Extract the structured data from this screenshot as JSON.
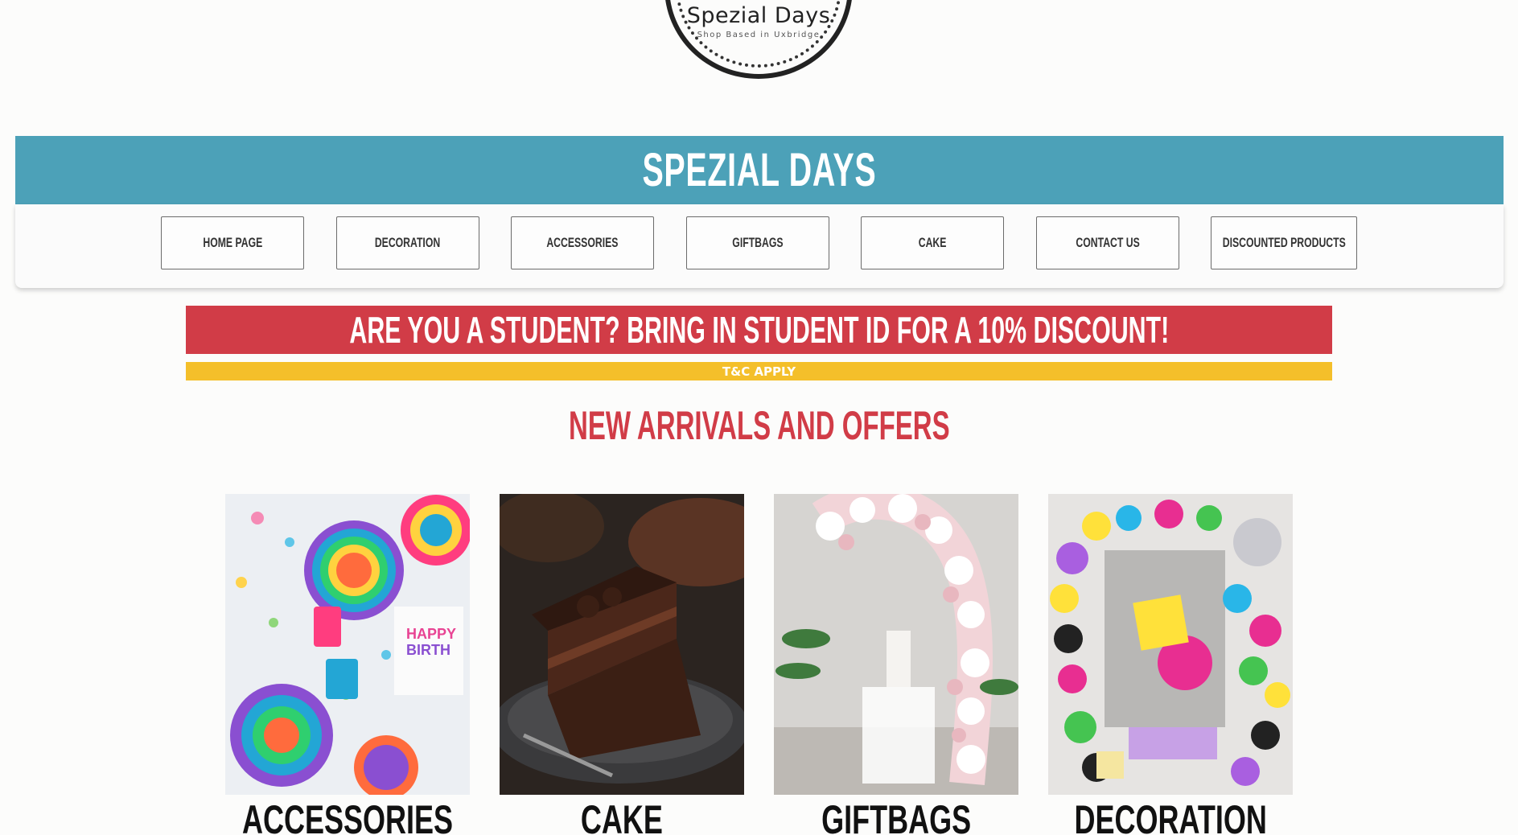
{
  "logo": {
    "name": "Spezial Days",
    "tagline": "Shop Based in Uxbridge"
  },
  "header": {
    "title": "SPEZIAL DAYS"
  },
  "nav": {
    "items": [
      {
        "label": "HOME PAGE"
      },
      {
        "label": "DECORATION"
      },
      {
        "label": "ACCESSORIES"
      },
      {
        "label": "GIFTBAGS"
      },
      {
        "label": "CAKE"
      },
      {
        "label": "CONTACT US"
      },
      {
        "label": "DISCOUNTED PRODUCTS"
      }
    ]
  },
  "promo": {
    "headline": "ARE YOU A STUDENT? BRING IN STUDENT ID FOR A 10% DISCOUNT!",
    "note": "T&C APPLY"
  },
  "section": {
    "title": "NEW ARRIVALS AND OFFERS"
  },
  "categories": [
    {
      "label": "ACCESSORIES"
    },
    {
      "label": "CAKE"
    },
    {
      "label": "GIFTBAGS"
    },
    {
      "label": "DECORATION"
    }
  ],
  "colors": {
    "header_band": "#4ca1b8",
    "promo_red": "#d13c47",
    "promo_yellow": "#f4bf2a",
    "page_background": "#fcfcfb"
  }
}
